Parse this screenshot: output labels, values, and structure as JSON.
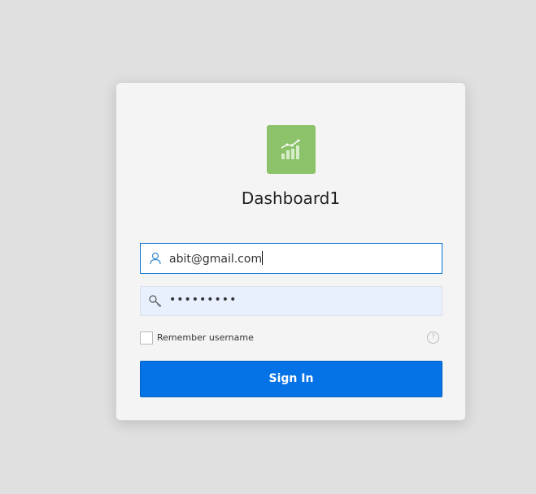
{
  "app": {
    "title": "Dashboard1",
    "logo_icon": "chart-growth-icon",
    "logo_color": "#8bc26a"
  },
  "form": {
    "username": {
      "value": "abit@gmail.com",
      "icon": "user-icon"
    },
    "password": {
      "value": "•••••••••",
      "icon": "key-icon"
    },
    "remember_label": "Remember username",
    "remember_checked": false,
    "help_icon": "question-circle-icon",
    "signin_label": "Sign In",
    "accent": "#0572e6"
  }
}
